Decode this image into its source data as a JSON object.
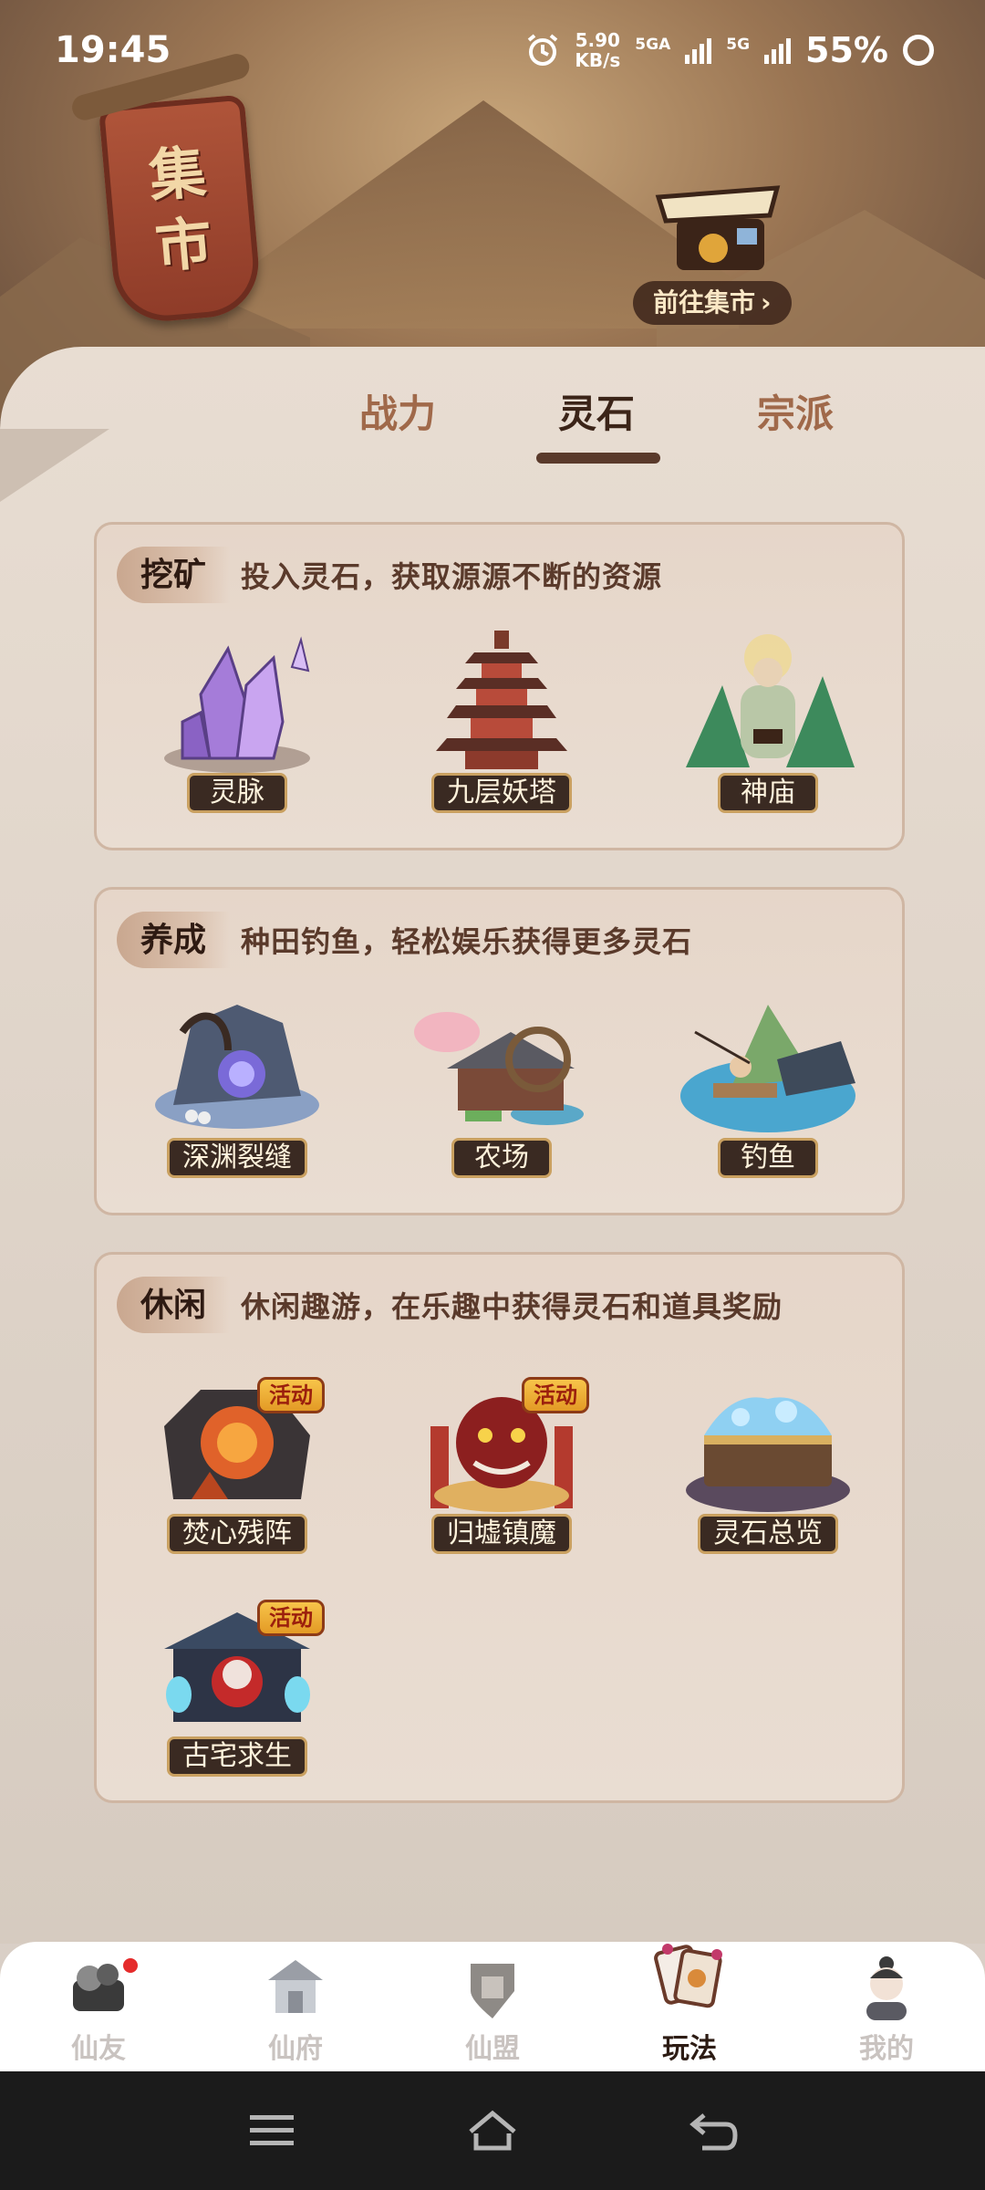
{
  "status_bar": {
    "time": "19:45",
    "speed_value": "5.90",
    "speed_unit": "KB/s",
    "net1": "5GA",
    "net2": "5G",
    "battery": "55%"
  },
  "banner": {
    "sign_char_1": "集",
    "sign_char_2": "市",
    "goto_market": "前往集市",
    "goto_arrow": "›"
  },
  "tabs": [
    {
      "label": "战力",
      "active": false
    },
    {
      "label": "灵石",
      "active": true
    },
    {
      "label": "宗派",
      "active": false
    }
  ],
  "sections": [
    {
      "tag": "挖矿",
      "desc": "投入灵石，获取源源不断的资源",
      "items": [
        {
          "label": "灵脉",
          "icon": "crystal-icon"
        },
        {
          "label": "九层妖塔",
          "icon": "pagoda-icon"
        },
        {
          "label": "神庙",
          "icon": "temple-icon"
        }
      ]
    },
    {
      "tag": "养成",
      "desc": "种田钓鱼，轻松娱乐获得更多灵石",
      "items": [
        {
          "label": "深渊裂缝",
          "icon": "abyss-icon"
        },
        {
          "label": "农场",
          "icon": "farm-icon"
        },
        {
          "label": "钓鱼",
          "icon": "fishing-icon"
        }
      ]
    },
    {
      "tag": "休闲",
      "desc": "休闲趣游，在乐趣中获得灵石和道具奖励",
      "items": [
        {
          "label": "焚心残阵",
          "icon": "fire-formation-icon",
          "badge": "活动"
        },
        {
          "label": "归墟镇魔",
          "icon": "demon-icon",
          "badge": "活动"
        },
        {
          "label": "灵石总览",
          "icon": "treasure-chest-icon"
        },
        {
          "label": "古宅求生",
          "icon": "haunted-house-icon",
          "badge": "活动"
        }
      ]
    }
  ],
  "bottom_nav": [
    {
      "label": "仙友",
      "icon": "friends-icon",
      "active": false
    },
    {
      "label": "仙府",
      "icon": "mansion-icon",
      "active": false
    },
    {
      "label": "仙盟",
      "icon": "alliance-icon",
      "active": false
    },
    {
      "label": "玩法",
      "icon": "gameplay-icon",
      "active": true
    },
    {
      "label": "我的",
      "icon": "profile-icon",
      "active": false
    }
  ],
  "colors": {
    "accent_dark": "#3b2418",
    "tab_inactive": "#a0694a",
    "badge": "#f7c44a",
    "notification": "#e52b2b"
  }
}
